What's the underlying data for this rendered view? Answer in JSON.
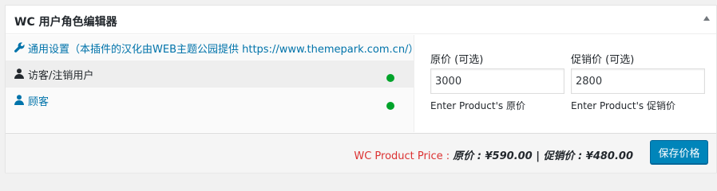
{
  "panel": {
    "title": "WC 用户角色编辑器",
    "toggle_icon": "arrow-up-icon"
  },
  "tabs": [
    {
      "label": "通用设置（本插件的汉化由WEB主题公园提供 https://www.themepark.com.cn/）",
      "icon": "wrench-icon",
      "color": "#0073aa"
    },
    {
      "label": "访客/注销用户",
      "icon": "user-icon",
      "color": "#23282d",
      "status": "green-dot",
      "active": true
    },
    {
      "label": "顾客",
      "icon": "user-icon",
      "color": "#0073aa",
      "status": "green-dot"
    }
  ],
  "fields": {
    "regular": {
      "label": "原价 (可选)",
      "value": "3000",
      "hint": "Enter Product's 原价"
    },
    "sale": {
      "label": "促销价 (可选)",
      "value": "2800",
      "hint": "Enter Product's 促销价"
    }
  },
  "footer": {
    "price_label": "WC Product Price : ",
    "price_value": "原价 : ¥590.00 | 促销价 : ¥480.00",
    "save_label": "保存价格"
  },
  "colors": {
    "link": "#0073aa",
    "status_green": "#00a32a",
    "price_label_red": "#dc3232",
    "primary_button": "#0085ba"
  }
}
